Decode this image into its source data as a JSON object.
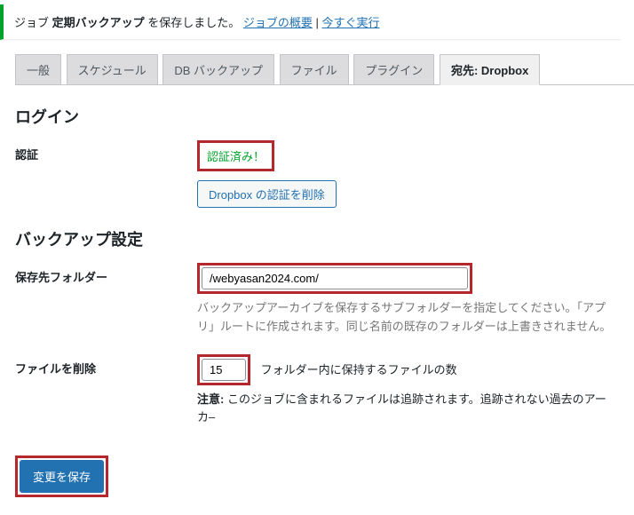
{
  "notice": {
    "prefix": "ジョブ ",
    "job_name": "定期バックアップ",
    "suffix": " を保存しました。",
    "link_overview": "ジョブの概要",
    "separator": " | ",
    "link_run": "今すぐ実行"
  },
  "tabs": [
    {
      "label": "一般"
    },
    {
      "label": "スケジュール"
    },
    {
      "label": "DB バックアップ"
    },
    {
      "label": "ファイル"
    },
    {
      "label": "プラグイン"
    },
    {
      "label": "宛先: Dropbox"
    }
  ],
  "sections": {
    "login_heading": "ログイン",
    "backup_heading": "バックアップ設定"
  },
  "auth": {
    "label": "認証",
    "status": "認証済み！",
    "delete_button": "Dropbox の認証を削除"
  },
  "folder": {
    "label": "保存先フォルダー",
    "value": "/webyasan2024.com/",
    "hint": "バックアップアーカイブを保存するサブフォルダーを指定してください。「アプリ」ルートに作成されます。同じ名前の既存のフォルダーは上書きされません。"
  },
  "delete_files": {
    "label": "ファイルを削除",
    "value": "15",
    "inline": "フォルダー内に保持するファイルの数",
    "note_label": "注意:",
    "note_text": " このジョブに含まれるファイルは追跡されます。追跡されない過去のアーカ–"
  },
  "submit": {
    "label": "変更を保存"
  }
}
